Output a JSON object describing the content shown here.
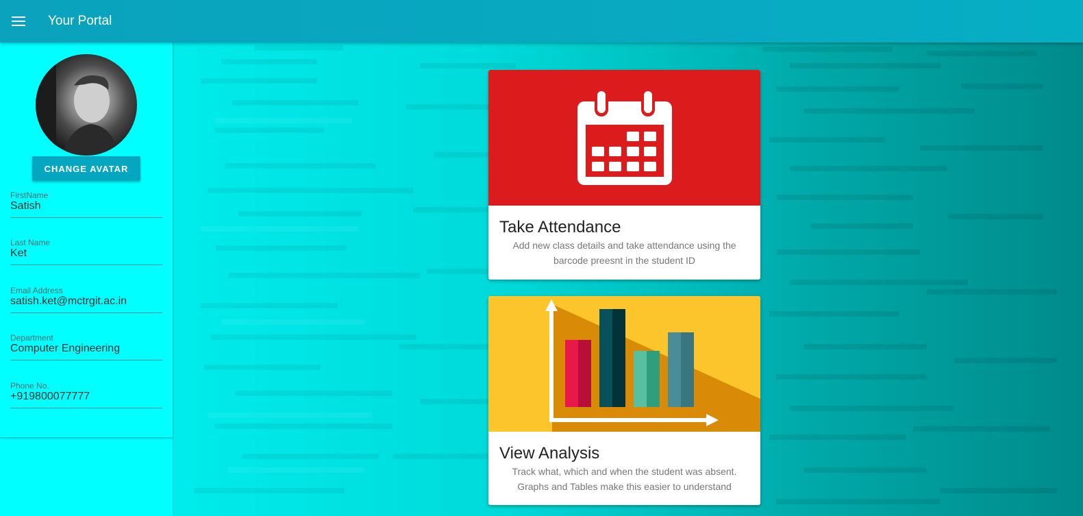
{
  "appbar": {
    "title": "Your Portal",
    "menu_icon": "menu-icon"
  },
  "profile": {
    "avatar": "profile-photo",
    "change_avatar_label": "CHANGE AVATAR",
    "fields": [
      {
        "label": "FirstName",
        "value": "Satish"
      },
      {
        "label": "Last Name",
        "value": "Ket"
      },
      {
        "label": "Email Address",
        "value": "satish.ket@mctrgit.ac.in"
      },
      {
        "label": "Department",
        "value": "Computer Engineering"
      },
      {
        "label": "Phone No.",
        "value": "+919800077777"
      }
    ]
  },
  "cards": [
    {
      "title": "Take Attendance",
      "description": "Add new class details and take attendance using the barcode preesnt in the student ID",
      "icon": "calendar-icon",
      "color": "#dc1c1c"
    },
    {
      "title": "View Analysis",
      "description": "Track what, which and when the student was absent. Graphs and Tables make this easier to understand",
      "icon": "bar-chart-icon",
      "color": "#fbc52b"
    }
  ],
  "colors": {
    "appbar": "#06aec4",
    "sidebar": "#00ffff",
    "button": "#05a6bf",
    "background": "#00d6d6"
  }
}
